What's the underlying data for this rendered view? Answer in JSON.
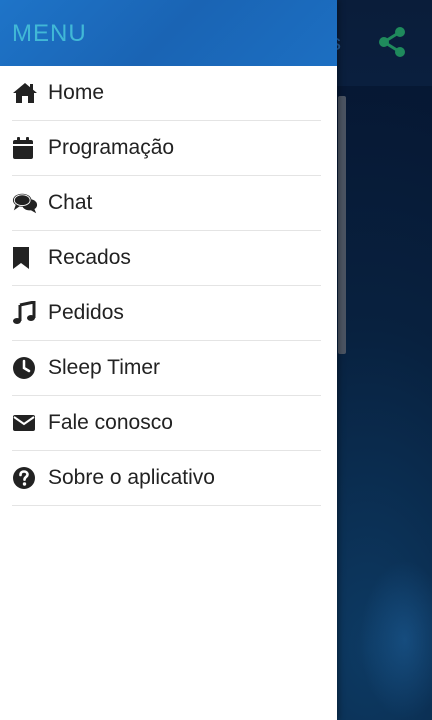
{
  "background": {
    "title_fragment": "s",
    "share_icon": "share-icon"
  },
  "drawer": {
    "title": "MENU",
    "items": [
      {
        "label": "Home",
        "icon": "home-icon"
      },
      {
        "label": "Programação",
        "icon": "calendar-icon"
      },
      {
        "label": "Chat",
        "icon": "comments-icon"
      },
      {
        "label": "Recados",
        "icon": "bookmark-icon"
      },
      {
        "label": "Pedidos",
        "icon": "music-icon"
      },
      {
        "label": "Sleep Timer",
        "icon": "clock-icon"
      },
      {
        "label": "Fale conosco",
        "icon": "envelope-icon"
      },
      {
        "label": "Sobre o aplicativo",
        "icon": "question-circle-icon"
      }
    ]
  },
  "colors": {
    "header_blue": "#1e74c8",
    "title_cyan": "#41b8d6",
    "share_green": "#1f8a5c"
  }
}
